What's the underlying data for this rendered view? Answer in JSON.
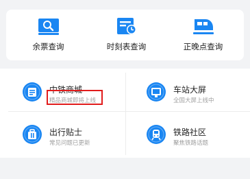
{
  "quick_actions": [
    {
      "label": "余票查询",
      "icon": "ticket-search-icon"
    },
    {
      "label": "时刻表查询",
      "icon": "timetable-icon"
    },
    {
      "label": "正晚点查询",
      "icon": "train-delay-icon"
    }
  ],
  "services": [
    {
      "title": "中铁商城",
      "subtitle": "精品商城即将上线",
      "icon": "mall-icon"
    },
    {
      "title": "车站大屏",
      "subtitle": "全国大屏上线中",
      "icon": "station-screen-icon"
    },
    {
      "title": "出行贴士",
      "subtitle": "常见问题已更新",
      "icon": "travel-tips-icon"
    },
    {
      "title": "铁路社区",
      "subtitle": "聚焦铁路话题",
      "icon": "railway-community-icon"
    }
  ],
  "colors": {
    "accent": "#1a86f2",
    "highlight": "#e11b1b"
  }
}
